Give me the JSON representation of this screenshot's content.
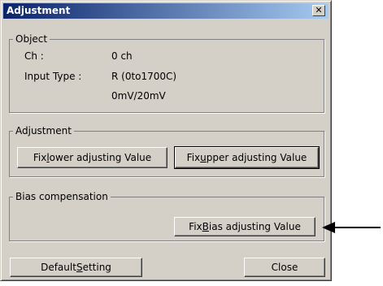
{
  "window": {
    "title": "Adjustment",
    "close_glyph": "✕"
  },
  "object": {
    "legend": "Object",
    "ch_label": "Ch :",
    "ch_value": "0 ch",
    "input_type_label": "Input Type :",
    "input_type_value": "R (0to1700C)",
    "input_range": "0mV/20mV"
  },
  "adjustment": {
    "legend": "Adjustment",
    "fix_lower": {
      "pre": "Fix ",
      "key": "l",
      "post": "ower adjusting Value"
    },
    "fix_upper": {
      "pre": "Fix ",
      "key": "u",
      "post": "pper adjusting Value"
    }
  },
  "bias": {
    "legend": "Bias compensation",
    "fix_bias": {
      "pre": "Fix ",
      "key": "B",
      "post": "ias adjusting Value"
    }
  },
  "footer": {
    "default_setting": {
      "pre": "Default ",
      "key": "S",
      "post": "etting"
    },
    "close": "Close"
  }
}
